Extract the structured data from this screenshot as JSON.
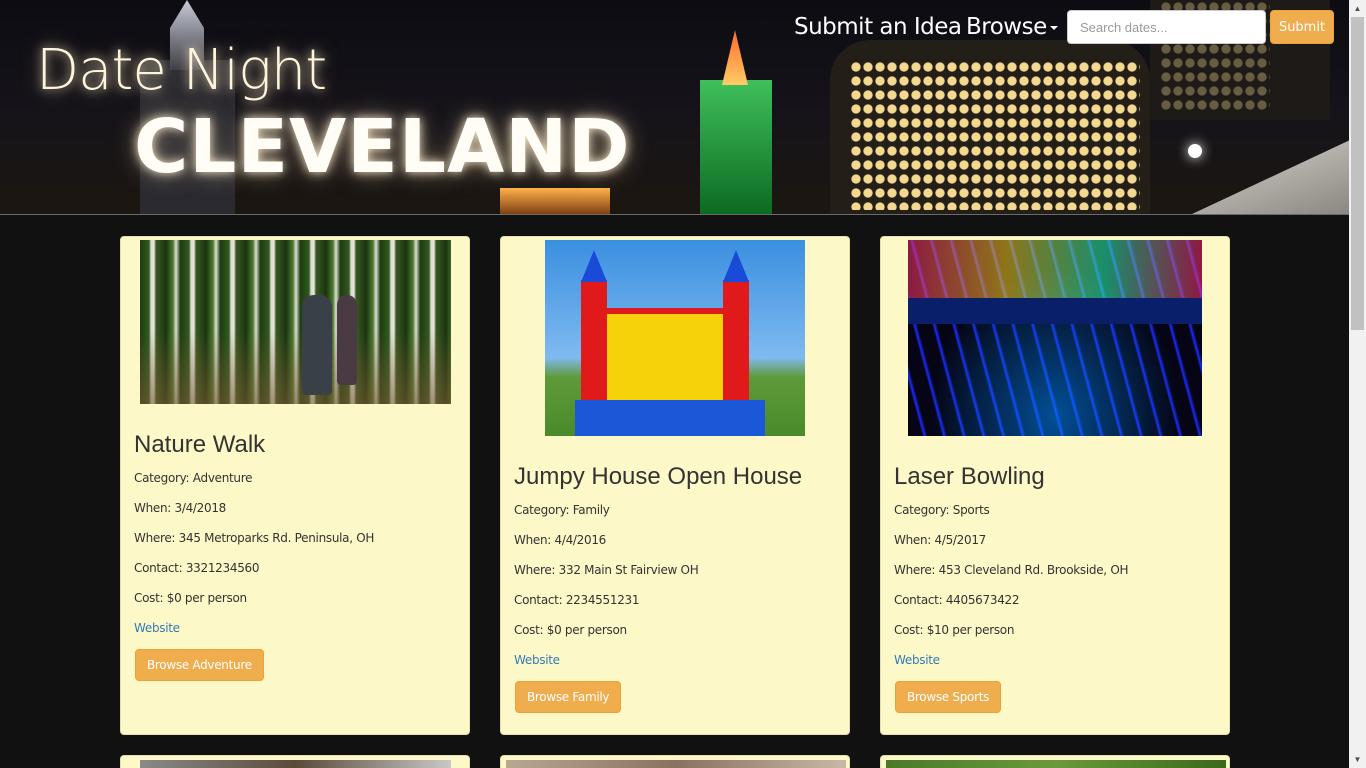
{
  "brand": {
    "line1": "Date Night",
    "line2": "CLEVELAND"
  },
  "nav": {
    "submit_idea": "Submit an Idea",
    "browse": "Browse"
  },
  "search": {
    "placeholder": "Search dates...",
    "submit_label": "Submit"
  },
  "cards": [
    {
      "title": "Nature Walk",
      "category": "Category: Adventure",
      "when": "When: 3/4/2018",
      "where": "Where: 345 Metroparks Rd. Peninsula, OH",
      "contact": "Contact: 3321234560",
      "cost": "Cost: $0 per person",
      "website": "Website",
      "button": "Browse Adventure",
      "image": "forest-hikers-photo"
    },
    {
      "title": "Jumpy House Open House",
      "category": "Category: Family",
      "when": "When: 4/4/2016",
      "where": "Where: 332 Main St Fairview OH",
      "contact": "Contact: 2234551231",
      "cost": "Cost: $0 per person",
      "website": "Website",
      "button": "Browse Family",
      "image": "bounce-castle-photo"
    },
    {
      "title": "Laser Bowling",
      "category": "Category: Sports",
      "when": "When: 4/5/2017",
      "where": "Where: 453 Cleveland Rd. Brookside, OH",
      "contact": "Contact: 4405673422",
      "cost": "Cost: $10 per person",
      "website": "Website",
      "button": "Browse Sports",
      "image": "neon-bowling-alley-photo"
    }
  ],
  "colors": {
    "accent": "#f0ad4e",
    "card_bg": "#fdf8c8",
    "page_bg": "#111111",
    "link": "#337ab7"
  }
}
